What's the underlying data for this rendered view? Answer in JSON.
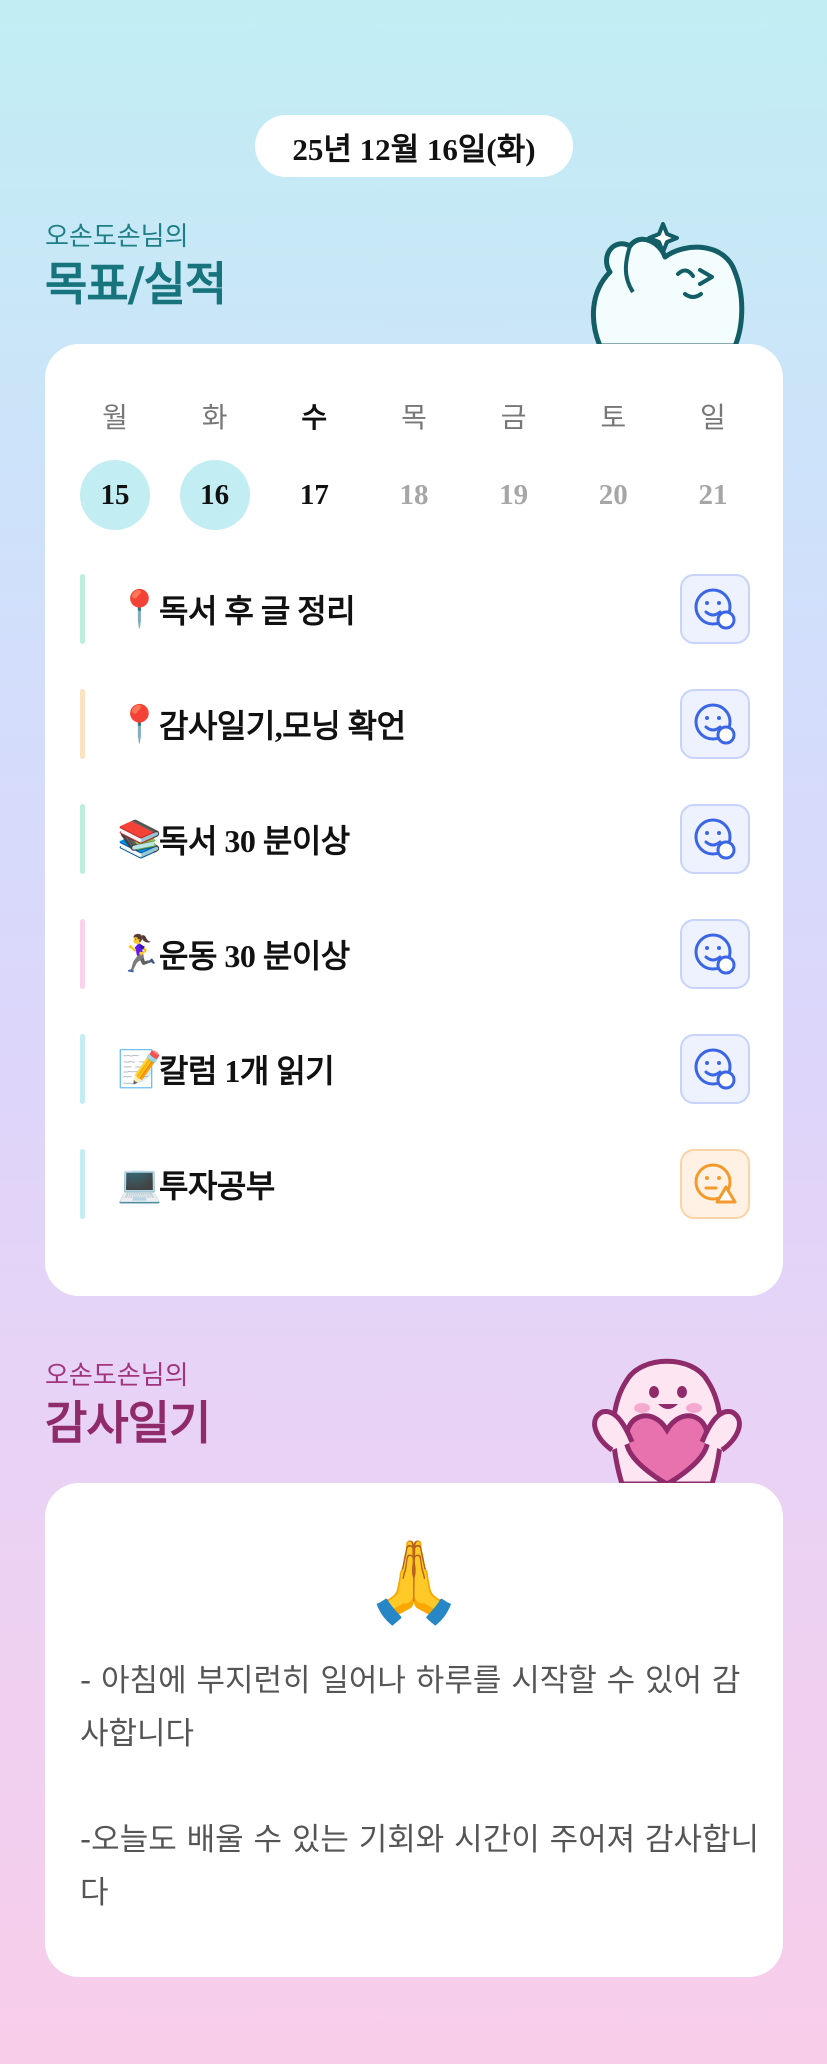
{
  "date_label": "25년 12월 16일(화)",
  "goals_section": {
    "subtitle": "오손도손님의",
    "title": "목표/실적"
  },
  "calendar": {
    "weekdays": [
      "월",
      "화",
      "수",
      "목",
      "금",
      "토",
      "일"
    ],
    "days": [
      "15",
      "16",
      "17",
      "18",
      "19",
      "20",
      "21"
    ]
  },
  "goals": [
    {
      "emoji": "📍",
      "text": "독서 후 글 정리",
      "bar_color": "#bdeedd",
      "status_icon": "smile-check-icon",
      "status_color": "#3a66e6"
    },
    {
      "emoji": "📍",
      "text": "감사일기,모닝 확언",
      "bar_color": "#fbe3c2",
      "status_icon": "smile-check-icon",
      "status_color": "#3a66e6"
    },
    {
      "emoji": "📚",
      "text": "독서 30 분이상",
      "bar_color": "#bdeedd",
      "status_icon": "smile-check-icon",
      "status_color": "#3a66e6"
    },
    {
      "emoji": "🏃‍♀️",
      "text": "운동 30 분이상",
      "bar_color": "#fbd2ea",
      "status_icon": "smile-check-icon",
      "status_color": "#3a66e6"
    },
    {
      "emoji": "📝",
      "text": "칼럼 1개 읽기",
      "bar_color": "#c2eef3",
      "status_icon": "smile-check-icon",
      "status_color": "#3a66e6"
    },
    {
      "emoji": "💻",
      "text": "투자공부",
      "bar_color": "#c2eef3",
      "status_icon": "smile-warning-icon",
      "status_color": "#f39a2c"
    }
  ],
  "thanks_section": {
    "subtitle": "오손도손님의",
    "title": "감사일기"
  },
  "thanks": {
    "emoji": "🙏",
    "text": "- 아침에 부지런히 일어나 하루를 시작할 수 있어 감사합니다\n\n-오늘도 배울 수 있는 기회와 시간이 주어져 감사합니다"
  }
}
